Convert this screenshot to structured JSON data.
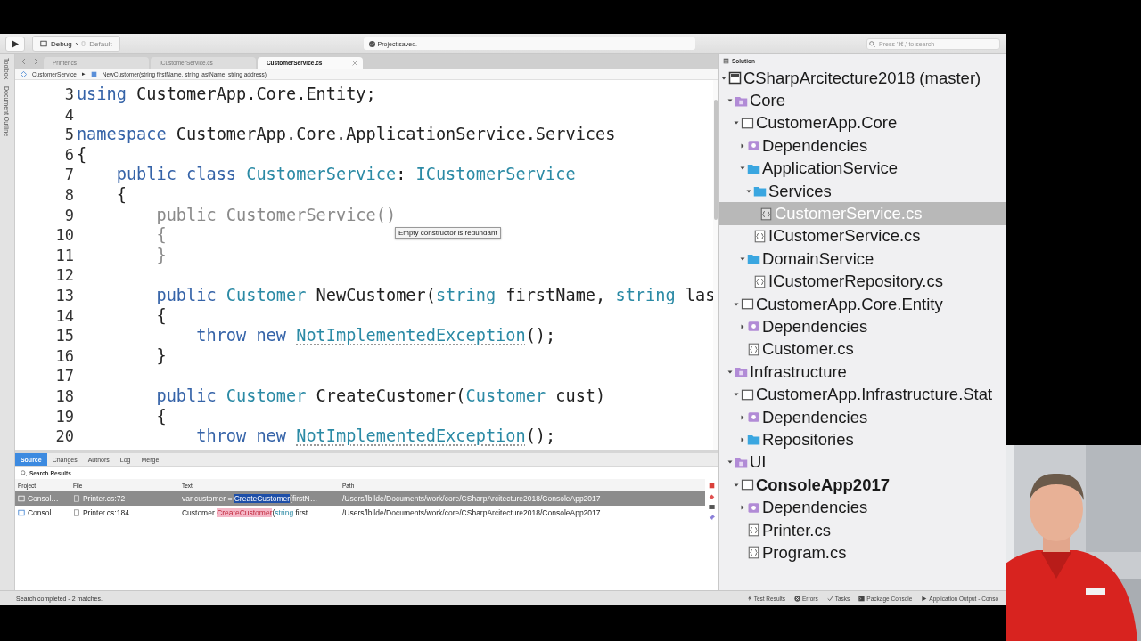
{
  "toolbar": {
    "configuration": "Debug",
    "separator": "›",
    "target": "Default",
    "status": "Project saved.",
    "search": {
      "placeholder": "Press '⌘,' to search"
    }
  },
  "side_strip": [
    "Toolbox",
    "Document Outline"
  ],
  "tabs": [
    {
      "label": "Printer.cs",
      "selected": false
    },
    {
      "label": "ICustomerService.cs",
      "selected": false
    },
    {
      "label": "CustomerService.cs",
      "selected": true
    }
  ],
  "breadcrumb": {
    "type": "CustomerService",
    "separator": "▸",
    "member": "NewCustomer(string firstName, string lastName, string address)"
  },
  "editor": {
    "lines": [
      {
        "number": "3",
        "tokens": [
          {
            "text": "using",
            "kind": "keyword"
          },
          {
            "text": " CustomerApp.Core.Entity;",
            "kind": "plain"
          }
        ]
      },
      {
        "number": "4"
      },
      {
        "number": "5",
        "tokens": [
          {
            "text": "namespace",
            "kind": "keyword"
          },
          {
            "text": " CustomerApp.Core.ApplicationService.Services",
            "kind": "plain"
          }
        ]
      },
      {
        "number": "6",
        "tokens": [
          {
            "text": "{",
            "kind": "plain"
          }
        ]
      },
      {
        "number": "7",
        "tokens": [
          {
            "text": "    public class ",
            "kind": "keyword"
          },
          {
            "text": "CustomerService",
            "kind": "type"
          },
          {
            "text": ": ",
            "kind": "plain"
          },
          {
            "text": "ICustomerService",
            "kind": "type"
          }
        ]
      },
      {
        "number": "8",
        "tokens": [
          {
            "text": "    {",
            "kind": "plain"
          }
        ]
      },
      {
        "number": "9",
        "tokens": [
          {
            "text": "        public CustomerService()",
            "kind": "dim"
          }
        ]
      },
      {
        "number": "10",
        "tokens": [
          {
            "text": "        {",
            "kind": "dim"
          }
        ]
      },
      {
        "number": "11",
        "tokens": [
          {
            "text": "        }",
            "kind": "dim"
          }
        ]
      },
      {
        "number": "12"
      },
      {
        "number": "13",
        "tokens": [
          {
            "text": "        public ",
            "kind": "keyword"
          },
          {
            "text": "Customer",
            "kind": "type"
          },
          {
            "text": " NewCustomer(",
            "kind": "plain"
          },
          {
            "text": "string",
            "kind": "type"
          },
          {
            "text": " firstName, ",
            "kind": "plain"
          },
          {
            "text": "string",
            "kind": "type"
          },
          {
            "text": " las",
            "kind": "plain"
          }
        ]
      },
      {
        "number": "14",
        "tokens": [
          {
            "text": "        {",
            "kind": "plain"
          }
        ]
      },
      {
        "number": "15",
        "tokens": [
          {
            "text": "            throw new ",
            "kind": "keyword"
          },
          {
            "text": "NotImplementedException",
            "kind": "hint"
          },
          {
            "text": "();",
            "kind": "plain"
          }
        ]
      },
      {
        "number": "16",
        "tokens": [
          {
            "text": "        }",
            "kind": "plain"
          }
        ]
      },
      {
        "number": "17"
      },
      {
        "number": "18",
        "tokens": [
          {
            "text": "        public ",
            "kind": "keyword"
          },
          {
            "text": "Customer",
            "kind": "type"
          },
          {
            "text": " CreateCustomer(",
            "kind": "plain"
          },
          {
            "text": "Customer",
            "kind": "type"
          },
          {
            "text": " cust)",
            "kind": "plain"
          }
        ]
      },
      {
        "number": "19",
        "tokens": [
          {
            "text": "        {",
            "kind": "plain"
          }
        ]
      },
      {
        "number": "20",
        "tokens": [
          {
            "text": "            throw new ",
            "kind": "keyword"
          },
          {
            "text": "NotImplementedException",
            "kind": "hint"
          },
          {
            "text": "();",
            "kind": "plain"
          }
        ]
      }
    ],
    "tooltip": "Empty constructor is redundant"
  },
  "pad": {
    "tabs": [
      {
        "label": "Source",
        "selected": true
      },
      {
        "label": "Changes",
        "selected": false
      },
      {
        "label": "Authors",
        "selected": false
      },
      {
        "label": "Log",
        "selected": false
      },
      {
        "label": "Merge",
        "selected": false
      }
    ],
    "title": "Search Results",
    "columns": [
      "Project",
      "File",
      "Text",
      "Path"
    ],
    "rows": [
      {
        "selected": true,
        "project": "Consol…",
        "file": "Printer.cs:72",
        "text": [
          {
            "text": "var customer = ",
            "kind": "plain"
          },
          {
            "text": "CreateCustomer",
            "kind": "match"
          },
          {
            "text": "(firstN…",
            "kind": "plain"
          }
        ],
        "path": "/Users/lbilde/Documents/work/core/CSharpArcitecture2018/ConsoleApp2017"
      },
      {
        "selected": false,
        "project": "Consol…",
        "file": "Printer.cs:184",
        "text": [
          {
            "text": "Customer ",
            "kind": "plain"
          },
          {
            "text": "CreateCustomer",
            "kind": "match"
          },
          {
            "text": "(",
            "kind": "plain"
          },
          {
            "text": "string",
            "kind": "type"
          },
          {
            "text": " first…",
            "kind": "plain"
          }
        ],
        "path": "/Users/lbilde/Documents/work/core/CSharpArcitecture2018/ConsoleApp2017"
      }
    ]
  },
  "status_bar": {
    "message": "Search completed - 2 matches.",
    "items": [
      {
        "label": "Test Results",
        "kind": "tests"
      },
      {
        "label": "Errors",
        "kind": "errors"
      },
      {
        "label": "Tasks",
        "kind": "tasks"
      },
      {
        "label": "Package Console",
        "kind": "console"
      },
      {
        "label": "Application Output - Conso",
        "kind": "output"
      }
    ]
  },
  "solution": {
    "title": "Solution",
    "tree": [
      {
        "label": "CSharpArcitecture2018 (master)",
        "kind": "solution",
        "expanded": true,
        "selected": false,
        "children": [
          {
            "label": "Core",
            "kind": "solution-folder",
            "expanded": true,
            "selected": false,
            "children": [
              {
                "label": "CustomerApp.Core",
                "kind": "project",
                "expanded": true,
                "selected": false,
                "startup": false,
                "children": [
                  {
                    "label": "Dependencies",
                    "kind": "dependencies",
                    "expanded": false,
                    "selected": false
                  },
                  {
                    "label": "ApplicationService",
                    "kind": "folder",
                    "expanded": true,
                    "selected": false,
                    "children": [
                      {
                        "label": "Services",
                        "kind": "folder",
                        "expanded": true,
                        "selected": false,
                        "children": [
                          {
                            "label": "CustomerService.cs",
                            "kind": "file",
                            "selected": true
                          }
                        ]
                      },
                      {
                        "label": "ICustomerService.cs",
                        "kind": "file",
                        "selected": false
                      }
                    ]
                  },
                  {
                    "label": "DomainService",
                    "kind": "folder",
                    "expanded": true,
                    "selected": false,
                    "children": [
                      {
                        "label": "ICustomerRepository.cs",
                        "kind": "file",
                        "selected": false
                      }
                    ]
                  }
                ]
              },
              {
                "label": "CustomerApp.Core.Entity",
                "kind": "project",
                "expanded": true,
                "selected": false,
                "startup": false,
                "children": [
                  {
                    "label": "Dependencies",
                    "kind": "dependencies",
                    "expanded": false,
                    "selected": false
                  },
                  {
                    "label": "Customer.cs",
                    "kind": "file",
                    "selected": false
                  }
                ]
              }
            ]
          },
          {
            "label": "Infrastructure",
            "kind": "solution-folder",
            "expanded": true,
            "selected": false,
            "children": [
              {
                "label": "CustomerApp.Infrastructure.Stat",
                "kind": "project",
                "expanded": true,
                "selected": false,
                "startup": false,
                "children": [
                  {
                    "label": "Dependencies",
                    "kind": "dependencies",
                    "expanded": false,
                    "selected": false
                  },
                  {
                    "label": "Repositories",
                    "kind": "folder",
                    "expanded": false,
                    "selected": false
                  }
                ]
              }
            ]
          },
          {
            "label": "UI",
            "kind": "solution-folder",
            "expanded": true,
            "selected": false,
            "children": [
              {
                "label": "ConsoleApp2017",
                "kind": "project",
                "expanded": true,
                "selected": false,
                "startup": true,
                "children": [
                  {
                    "label": "Dependencies",
                    "kind": "dependencies",
                    "expanded": false,
                    "selected": false
                  },
                  {
                    "label": "Printer.cs",
                    "kind": "file",
                    "selected": false
                  },
                  {
                    "label": "Program.cs",
                    "kind": "file",
                    "selected": false
                  }
                ]
              }
            ]
          }
        ]
      }
    ]
  },
  "video_overlay": {
    "kind": "picture"
  }
}
